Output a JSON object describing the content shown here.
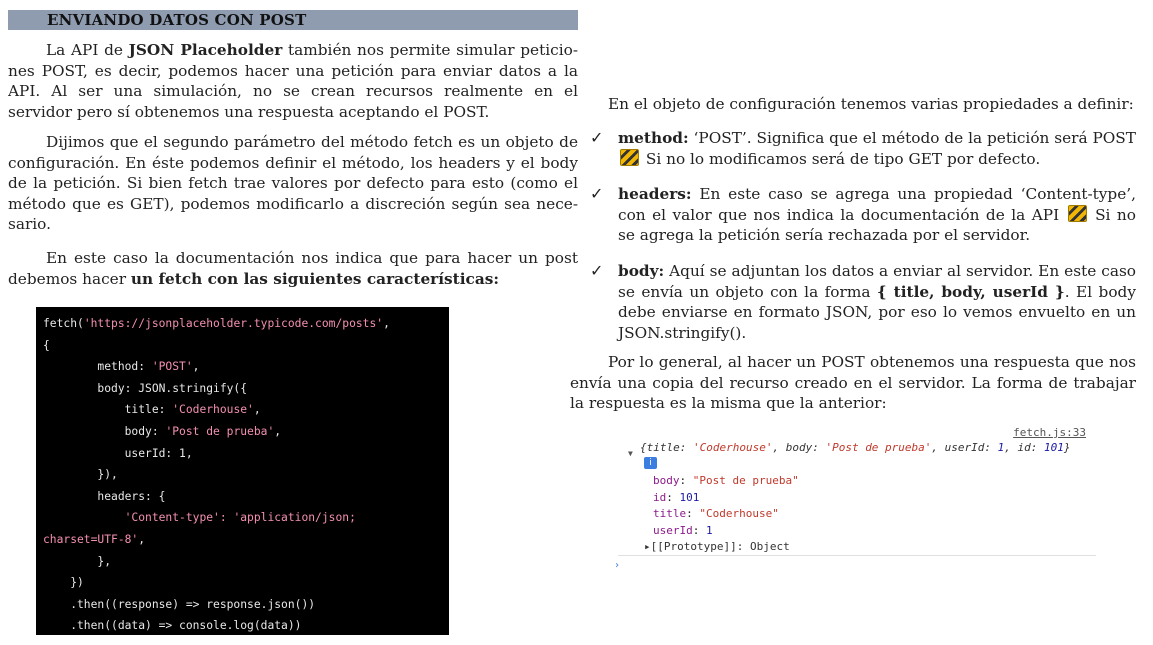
{
  "section": {
    "title": "ENVIANDO DATOS CON POST"
  },
  "left": {
    "p1": {
      "a": "La API de ",
      "b": "JSON Placeholder",
      "c": " también nos permite simular peticio-nes POST, es decir, podemos hacer una petición para enviar datos a la API. Al ser una simulación, no se crean recursos realmente en el servidor pero sí obtenemos una respuesta aceptando el POST."
    },
    "p2": "Dijimos que el segundo parámetro del método fetch es un objeto de configuración. En éste podemos definir el método, los headers y el body de la petición. Si bien fetch trae valores por defecto para esto (como el método que es GET), podemos modificarlo a discreción según sea nece-sario.",
    "p3": {
      "a": "En este caso la documentación nos indica que para hacer un post debemos hacer ",
      "b": "un fetch con las siguientes características:"
    }
  },
  "code": {
    "l1a": "fetch(",
    "l1s": "'https://jsonplaceholder.typicode.com/posts'",
    "l1b": ",",
    "l2": "{",
    "l3a": "        method: ",
    "l3s": "'POST'",
    "l3b": ",",
    "l4": "        body: JSON.stringify({",
    "l5a": "            title: ",
    "l5s": "'Coderhouse'",
    "l5b": ",",
    "l6a": "            body: ",
    "l6s": "'Post de prueba'",
    "l6b": ",",
    "l7": "            userId: 1,",
    "l8": "        }),",
    "l9": "        headers: {",
    "l10a": "            ",
    "l10s": "'Content-type': 'application/json;",
    "l11s": "charset=UTF-8'",
    "l11b": ",",
    "l12": "        },",
    "l13": "    })",
    "l14": "    .then((response) => response.json())",
    "l15": "    .then((data) => console.log(data))"
  },
  "right": {
    "intro": "En el objeto de configuración tenemos varias propiedades a definir:",
    "check": "✓",
    "b1": {
      "key": "method:",
      "t1": " ‘POST’. Significa que el método de la petición será POST ",
      "t2": " Si no lo modificamos será de tipo GET por defecto."
    },
    "b2": {
      "key": "headers:",
      "t1": " En este caso se agrega una propiedad ‘Content-type’, con el valor que nos indica la documentación de la API ",
      "t2": " Si no se agrega la petición sería rechazada por el servidor."
    },
    "b3": {
      "key": "body:",
      "t1": " Aquí se adjuntan los datos a enviar al servidor. En este caso se envía un objeto con la forma ",
      "t2": "{ title, body, userId }",
      "t3": ". El body debe enviarse en formato JSON, por eso lo vemos envuelto en un JSON.stringify()."
    },
    "p_end": "Por lo general, al hacer un POST obtenemos una respuesta que nos envía una copia del recurso creado en el servidor. La forma de trabajar la respuesta es la misma que la anterior:"
  },
  "console": {
    "source": "fetch.js:33",
    "summary": {
      "open": "{title: ",
      "title": "'Coderhouse'",
      "mid1": ", body: ",
      "body": "'Post de prueba'",
      "mid2": ", userId: ",
      "userId": "1",
      "mid3": ", id: ",
      "id": "101",
      "close": "}"
    },
    "info": "i",
    "rows": [
      {
        "key": "body",
        "value": "\"Post de prueba\"",
        "kind": "s"
      },
      {
        "key": "id",
        "value": "101",
        "kind": "n"
      },
      {
        "key": "title",
        "value": "\"Coderhouse\"",
        "kind": "s"
      },
      {
        "key": "userId",
        "value": "1",
        "kind": "n"
      }
    ],
    "proto": "▸[[Prototype]]: Object",
    "prompt": "›"
  }
}
